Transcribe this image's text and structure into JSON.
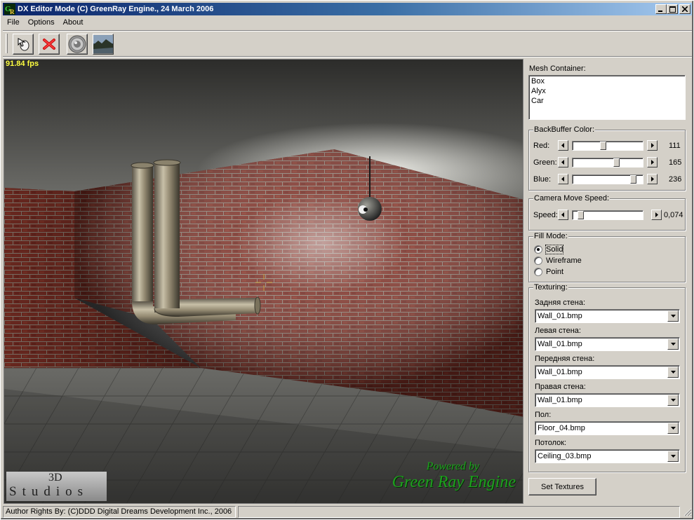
{
  "window": {
    "title": "DX Editor Mode  (C) GreenRay Engine., 24 March 2006",
    "icon": "greenray-logo-icon"
  },
  "menu": [
    "File",
    "Options",
    "About"
  ],
  "toolbar": {
    "buttons": [
      {
        "name": "select-tool",
        "icon": "pointer-cursor-icon"
      },
      {
        "name": "delete-tool",
        "icon": "red-x-icon"
      },
      {
        "name": "sound-tool",
        "icon": "speaker-icon"
      },
      {
        "name": "landscape-tool",
        "icon": "landscape-icon"
      }
    ]
  },
  "viewport": {
    "fps": "91.84 fps",
    "logo_line1": "3D",
    "logo_line2": "Studios",
    "powered_line1": "Powered by",
    "powered_line2": "Green Ray Engine",
    "powered_color": "#1ea01e",
    "fps_color": "#ffff40"
  },
  "panel": {
    "mesh_label": "Mesh Container:",
    "meshes": [
      "Box",
      "Alyx",
      "Car"
    ],
    "backbuffer": {
      "title": "BackBuffer Color:",
      "channels": [
        {
          "label": "Red:",
          "value": "111",
          "level": 0.435
        },
        {
          "label": "Green:",
          "value": "165",
          "level": 0.647
        },
        {
          "label": "Blue:",
          "value": "236",
          "level": 0.925
        }
      ]
    },
    "camera": {
      "title": "Camera Move Speed:",
      "label": "Speed:",
      "value": "0,074",
      "level": 0.074
    },
    "fill_mode": {
      "title": "Fill Mode:",
      "options": [
        "Solid",
        "Wireframe",
        "Point"
      ],
      "selected": "Solid"
    },
    "texturing": {
      "title": "Texturing:",
      "slots": [
        {
          "label": "Задняя стена:",
          "value": "Wall_01.bmp"
        },
        {
          "label": "Левая стена:",
          "value": "Wall_01.bmp"
        },
        {
          "label": "Передняя стена:",
          "value": "Wall_01.bmp"
        },
        {
          "label": "Правая стена:",
          "value": "Wall_01.bmp"
        },
        {
          "label": "Пол:",
          "value": "Floor_04.bmp"
        },
        {
          "label": "Потолок:",
          "value": "Ceiling_03.bmp"
        }
      ]
    },
    "set_textures": "Set Textures"
  },
  "status": {
    "text": "Author Rights By: (C)DDD Digital Dreams Development Inc., 2006",
    "pane2": ""
  }
}
